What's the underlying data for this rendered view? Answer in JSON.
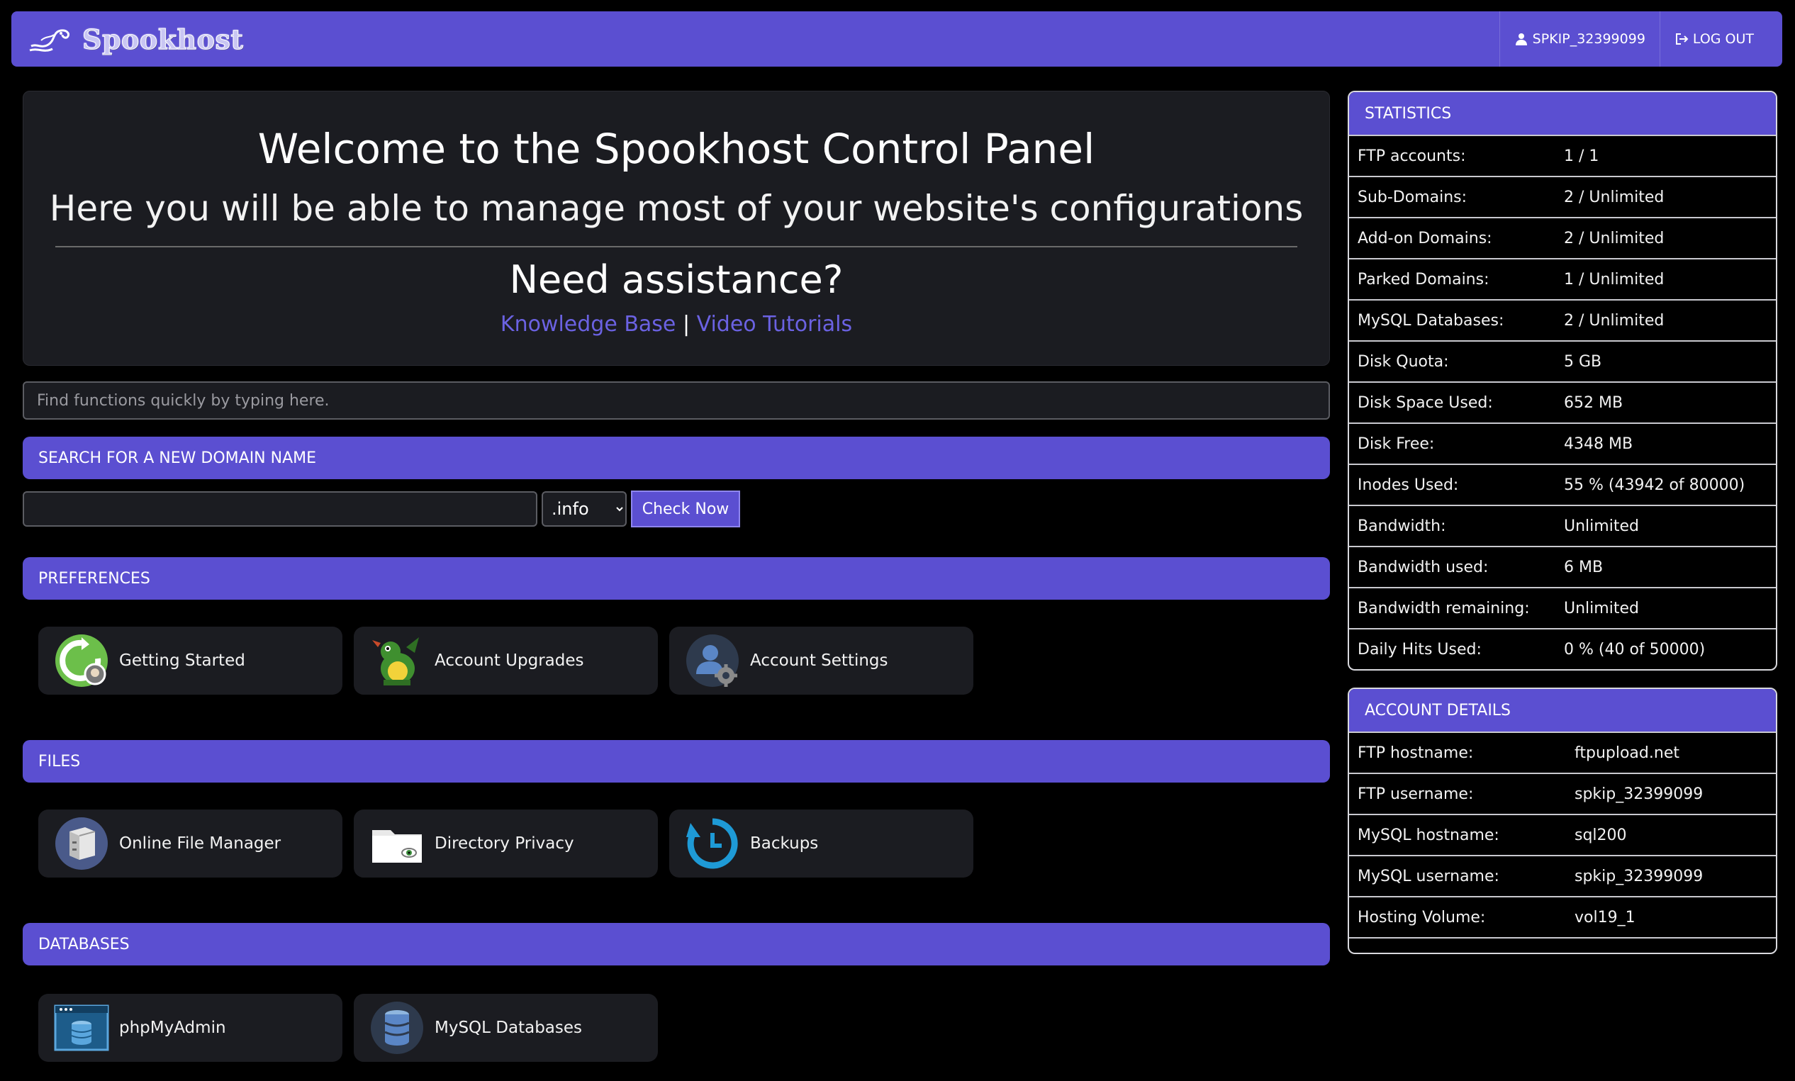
{
  "header": {
    "brand": "Spookhost",
    "username": "SPKIP_32399099",
    "logout_label": "LOG OUT"
  },
  "welcome": {
    "title": "Welcome to the Spookhost Control Panel",
    "subtitle": "Here you will be able to manage most of your website's configurations",
    "assist": "Need assistance?",
    "knowledge_base": "Knowledge Base",
    "separator": "|",
    "video_tutorials": "Video Tutorials"
  },
  "search": {
    "placeholder": "Find functions quickly by typing here."
  },
  "domain_search": {
    "title": "SEARCH FOR A NEW DOMAIN NAME",
    "input_value": "",
    "tld_selected": ".info",
    "button": "Check Now"
  },
  "sections": {
    "preferences": {
      "title": "PREFERENCES",
      "items": [
        {
          "label": "Getting Started",
          "icon": "getting-started-icon"
        },
        {
          "label": "Account Upgrades",
          "icon": "dragon-icon"
        },
        {
          "label": "Account Settings",
          "icon": "account-settings-icon"
        }
      ]
    },
    "files": {
      "title": "FILES",
      "items": [
        {
          "label": "Online File Manager",
          "icon": "file-manager-icon"
        },
        {
          "label": "Directory Privacy",
          "icon": "folder-eye-icon"
        },
        {
          "label": "Backups",
          "icon": "backup-icon"
        }
      ]
    },
    "databases": {
      "title": "DATABASES",
      "items": [
        {
          "label": "phpMyAdmin",
          "icon": "phpmyadmin-icon"
        },
        {
          "label": "MySQL Databases",
          "icon": "database-icon"
        }
      ]
    }
  },
  "statistics": {
    "title": "STATISTICS",
    "rows": [
      {
        "key": "FTP accounts:",
        "value": "1 / 1"
      },
      {
        "key": "Sub-Domains:",
        "value": "2 / Unlimited"
      },
      {
        "key": "Add-on Domains:",
        "value": "2 / Unlimited"
      },
      {
        "key": "Parked Domains:",
        "value": "1 / Unlimited"
      },
      {
        "key": "MySQL Databases:",
        "value": "2 / Unlimited"
      },
      {
        "key": "Disk Quota:",
        "value": "5 GB"
      },
      {
        "key": "Disk Space Used:",
        "value": "652 MB"
      },
      {
        "key": "Disk Free:",
        "value": "4348 MB"
      },
      {
        "key": "Inodes Used:",
        "value": "55 % (43942 of 80000)"
      },
      {
        "key": "Bandwidth:",
        "value": "Unlimited"
      },
      {
        "key": "Bandwidth used:",
        "value": "6 MB"
      },
      {
        "key": "Bandwidth remaining:",
        "value": "Unlimited"
      },
      {
        "key": "Daily Hits Used:",
        "value": "0 % (40 of 50000)"
      }
    ]
  },
  "account_details": {
    "title": "ACCOUNT DETAILS",
    "rows": [
      {
        "key": "FTP hostname:",
        "value": "ftpupload.net"
      },
      {
        "key": "FTP username:",
        "value": "spkip_32399099"
      },
      {
        "key": "MySQL hostname:",
        "value": "sql200"
      },
      {
        "key": "MySQL username:",
        "value": "spkip_32399099"
      },
      {
        "key": "Hosting Volume:",
        "value": "vol19_1"
      }
    ]
  },
  "colors": {
    "accent": "#5b4fd1",
    "link": "#6b62e2",
    "panel_bg": "#1b1c21",
    "page_bg": "#000000"
  }
}
